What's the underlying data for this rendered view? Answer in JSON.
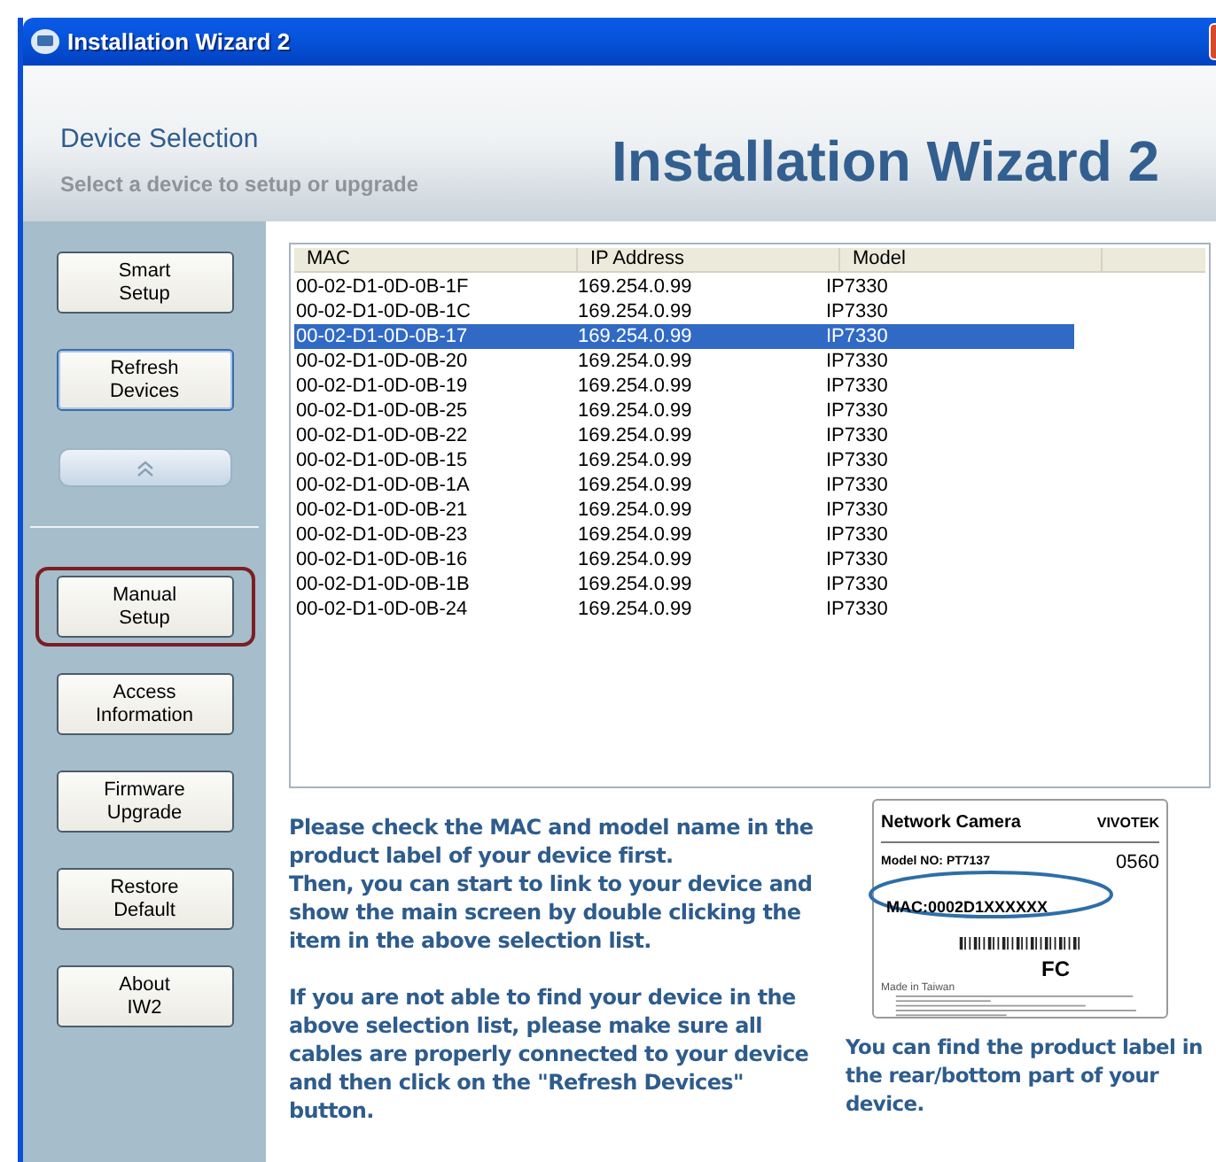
{
  "window": {
    "title": "Installation Wizard 2"
  },
  "header": {
    "title": "Device Selection",
    "subtitle": "Select a device to setup or upgrade",
    "logo_text": "Installation Wizard 2"
  },
  "sidebar": {
    "buttons": [
      {
        "kind": "button",
        "label": "Smart\nSetup",
        "focused": false,
        "highlighted": false
      },
      {
        "kind": "button",
        "label": "Refresh\nDevices",
        "focused": true,
        "highlighted": false
      },
      {
        "kind": "collapse",
        "focused": false,
        "highlighted": false
      },
      {
        "kind": "divider"
      },
      {
        "kind": "button",
        "label": "Manual\nSetup",
        "focused": false,
        "highlighted": true
      },
      {
        "kind": "button",
        "label": "Access\nInformation",
        "focused": false,
        "highlighted": false
      },
      {
        "kind": "button",
        "label": "Firmware\nUpgrade",
        "focused": false,
        "highlighted": false
      },
      {
        "kind": "button",
        "label": "Restore\nDefault",
        "focused": false,
        "highlighted": false
      },
      {
        "kind": "button",
        "label": "About\nIW2",
        "focused": false,
        "highlighted": false
      }
    ]
  },
  "table": {
    "columns": [
      "MAC",
      "IP Address",
      "Model"
    ],
    "rows": [
      {
        "mac": "00-02-D1-0D-0B-1F",
        "ip": "169.254.0.99",
        "model": "IP7330",
        "selected": false
      },
      {
        "mac": "00-02-D1-0D-0B-1C",
        "ip": "169.254.0.99",
        "model": "IP7330",
        "selected": false
      },
      {
        "mac": "00-02-D1-0D-0B-17",
        "ip": "169.254.0.99",
        "model": "IP7330",
        "selected": true
      },
      {
        "mac": "00-02-D1-0D-0B-20",
        "ip": "169.254.0.99",
        "model": "IP7330",
        "selected": false
      },
      {
        "mac": "00-02-D1-0D-0B-19",
        "ip": "169.254.0.99",
        "model": "IP7330",
        "selected": false
      },
      {
        "mac": "00-02-D1-0D-0B-25",
        "ip": "169.254.0.99",
        "model": "IP7330",
        "selected": false
      },
      {
        "mac": "00-02-D1-0D-0B-22",
        "ip": "169.254.0.99",
        "model": "IP7330",
        "selected": false
      },
      {
        "mac": "00-02-D1-0D-0B-15",
        "ip": "169.254.0.99",
        "model": "IP7330",
        "selected": false
      },
      {
        "mac": "00-02-D1-0D-0B-1A",
        "ip": "169.254.0.99",
        "model": "IP7330",
        "selected": false
      },
      {
        "mac": "00-02-D1-0D-0B-21",
        "ip": "169.254.0.99",
        "model": "IP7330",
        "selected": false
      },
      {
        "mac": "00-02-D1-0D-0B-23",
        "ip": "169.254.0.99",
        "model": "IP7330",
        "selected": false
      },
      {
        "mac": "00-02-D1-0D-0B-16",
        "ip": "169.254.0.99",
        "model": "IP7330",
        "selected": false
      },
      {
        "mac": "00-02-D1-0D-0B-1B",
        "ip": "169.254.0.99",
        "model": "IP7330",
        "selected": false
      },
      {
        "mac": "00-02-D1-0D-0B-24",
        "ip": "169.254.0.99",
        "model": "IP7330",
        "selected": false
      }
    ]
  },
  "instructions": [
    "Please check the MAC and model name in the product label of your device first.\nThen, you can start to link to your device and show the main screen by double clicking the item in the above selection list.",
    "If you are not able to find your device in the above selection list, please make sure all cables are properly connected to your device and then click on the \"Refresh Devices\" button."
  ],
  "product_label": {
    "title": "Network Camera",
    "brand": "VIVOTEK",
    "model": "Model NO: PT7137",
    "cert_number": "0560",
    "mac": "MAC:0002D1XXXXXX",
    "fcc": "FC",
    "origin": "Made in Taiwan"
  },
  "caption": "You can find the product label in the rear/bottom part of your device."
}
